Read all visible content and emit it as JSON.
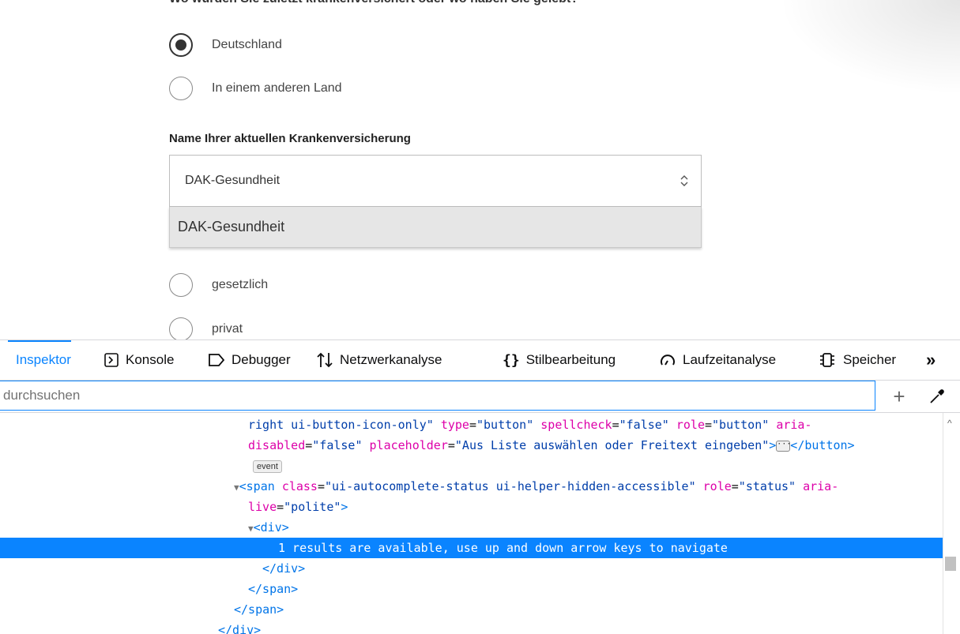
{
  "page": {
    "heading_partial": "Wo wurden Sie zuletzt krankenversichert oder wo haben Sie gelebt?",
    "residence_options": [
      {
        "label": "Deutschland",
        "checked": true
      },
      {
        "label": "In einem anderen Land",
        "checked": false
      }
    ],
    "insurance_label": "Name Ihrer aktuellen Krankenversicherung",
    "insurance_value": "DAK-Gesundheit",
    "dropdown_option": "DAK-Gesundheit",
    "type_options": [
      {
        "label": "gesetzlich",
        "checked": false
      },
      {
        "label": "privat",
        "checked": false
      }
    ]
  },
  "devtools": {
    "tabs": [
      {
        "label": "Inspektor",
        "icon": "inspector-icon",
        "active": true
      },
      {
        "label": "Konsole",
        "icon": "console-icon",
        "active": false
      },
      {
        "label": "Debugger",
        "icon": "debugger-icon",
        "active": false
      },
      {
        "label": "Netzwerkanalyse",
        "icon": "network-icon",
        "active": false
      },
      {
        "label": "Stilbearbeitung",
        "icon": "style-editor-icon",
        "active": false
      },
      {
        "label": "Laufzeitanalyse",
        "icon": "performance-icon",
        "active": false
      },
      {
        "label": "Speicher",
        "icon": "memory-icon",
        "active": false
      }
    ],
    "more_tabs_label": "»",
    "search_placeholder": "HTML durchsuchen",
    "search_visible_text": "durchsuchen",
    "add_node_label": "+",
    "markup_lines": {
      "l1_a": "right ui-button-icon-only\"",
      "l1_type_attr": "type",
      "l1_type_val": "\"button\"",
      "l1_spell_attr": "spellcheck",
      "l1_spell_val": "\"false\"",
      "l1_role_attr": "role",
      "l1_role_val": "\"button\"",
      "l1_aria_attr": "aria-",
      "l2_aria_attr": "disabled",
      "l2_aria_val": "\"false\"",
      "l2_ph_attr": "placeholder",
      "l2_ph_val": "\"Aus Liste auswählen oder Freitext eingeben\"",
      "l2_close": "</button>",
      "event_badge": "event",
      "span_open": "<span",
      "span_class_attr": "class",
      "span_class_val": "\"ui-autocomplete-status ui-helper-hidden-accessible\"",
      "span_role_attr": "role",
      "span_role_val": "\"status\"",
      "span_aria_attr": "aria-",
      "span_live_attr": "live",
      "span_live_val": "\"polite\"",
      "div_open": "<div>",
      "selected_text": "1 results are available, use up and down arrow keys to navigate",
      "div_close": "</div>",
      "span_close1": "</span>",
      "span_close2": "</span>",
      "div_close2": "</div>"
    }
  },
  "colors": {
    "accent": "#0a84ff",
    "tag": "#0074e8",
    "attr": "#dd00a9",
    "value": "#003eaa"
  }
}
